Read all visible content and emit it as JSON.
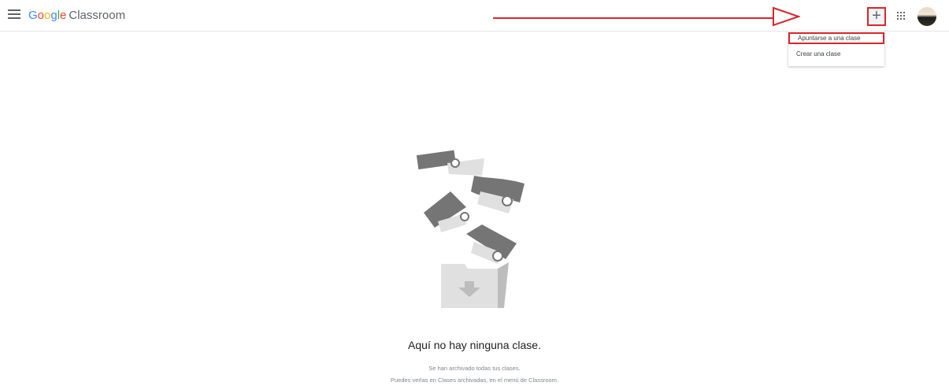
{
  "header": {
    "brand_letters": [
      "G",
      "o",
      "o",
      "g",
      "l",
      "e"
    ],
    "product": "Classroom",
    "plus_label": "+"
  },
  "dropdown": {
    "items": [
      {
        "label": "Apuntarse a una clase"
      },
      {
        "label": "Crear una clase"
      }
    ]
  },
  "empty_state": {
    "title": "Aquí no hay ninguna clase.",
    "line1": "Se han archivado todas tus clases.",
    "line2": "Puedes verlas en Clases archivadas, en el menú de Classroom."
  },
  "colors": {
    "annotation_red": "#d9262a",
    "google_blue": "#4285f4",
    "google_red": "#ea4335",
    "google_yellow": "#fbbc05",
    "google_green": "#34a853"
  },
  "icons": [
    "menu-icon",
    "plus-icon",
    "apps-grid-icon",
    "avatar",
    "annotation-arrow",
    "archive-illustration"
  ]
}
